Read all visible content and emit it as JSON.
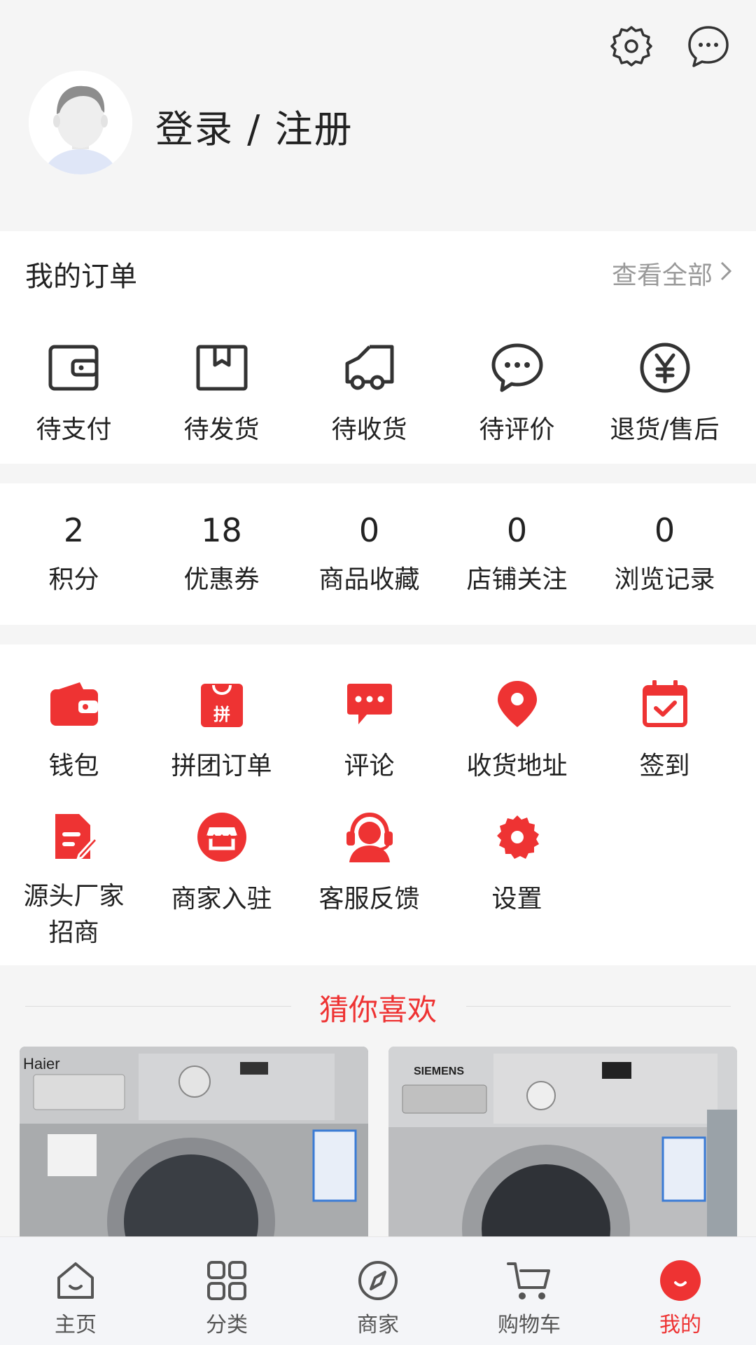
{
  "header": {
    "login_label": "登录 / 注册",
    "settings_icon": "gear-icon",
    "message_icon": "chat-bubble-icon"
  },
  "orders": {
    "title": "我的订单",
    "view_all": "查看全部",
    "items": [
      {
        "label": "待支付",
        "icon": "wallet-icon"
      },
      {
        "label": "待发货",
        "icon": "box-icon"
      },
      {
        "label": "待收货",
        "icon": "truck-icon"
      },
      {
        "label": "待评价",
        "icon": "comment-icon"
      },
      {
        "label": "退货/售后",
        "icon": "yen-icon"
      }
    ]
  },
  "stats": [
    {
      "value": "2",
      "label": "积分"
    },
    {
      "value": "18",
      "label": "优惠券"
    },
    {
      "value": "0",
      "label": "商品收藏"
    },
    {
      "value": "0",
      "label": "店铺关注"
    },
    {
      "value": "0",
      "label": "浏览记录"
    }
  ],
  "tools": {
    "row1": [
      {
        "label": "钱包",
        "icon": "wallet-icon"
      },
      {
        "label": "拼团订单",
        "icon": "group-buy-bag-icon",
        "badge": "拼"
      },
      {
        "label": "评论",
        "icon": "comment-icon"
      },
      {
        "label": "收货地址",
        "icon": "location-pin-icon"
      },
      {
        "label": "签到",
        "icon": "calendar-check-icon"
      }
    ],
    "row2": [
      {
        "label": "源头厂家",
        "label2": "招商",
        "icon": "document-edit-icon"
      },
      {
        "label": "商家入驻",
        "icon": "storefront-icon"
      },
      {
        "label": "客服反馈",
        "icon": "customer-service-icon"
      },
      {
        "label": "设置",
        "icon": "gear-icon"
      }
    ]
  },
  "guess": {
    "title": "猜你喜欢",
    "products": [
      {
        "brand": "Haier",
        "image": "washing-machine-photo"
      },
      {
        "brand": "SIEMENS",
        "image": "washing-machine-photo"
      }
    ]
  },
  "tabbar": {
    "active": 4,
    "accent": "#e33333",
    "items": [
      {
        "label": "主页",
        "icon": "home-icon"
      },
      {
        "label": "分类",
        "icon": "grid-icon"
      },
      {
        "label": "商家",
        "icon": "compass-icon"
      },
      {
        "label": "购物车",
        "icon": "cart-icon"
      },
      {
        "label": "我的",
        "icon": "profile-icon"
      }
    ]
  }
}
